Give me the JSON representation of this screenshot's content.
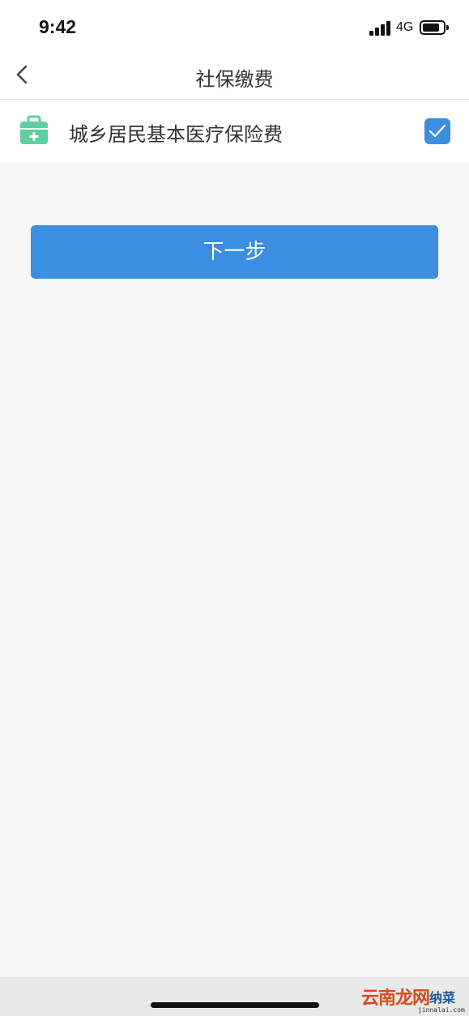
{
  "status_bar": {
    "time": "9:42",
    "network": "4G"
  },
  "nav": {
    "title": "社保缴费"
  },
  "item": {
    "label": "城乡居民基本医疗保险费",
    "checked": true,
    "icon": "medical-kit-icon",
    "icon_color": "#5dcfa0"
  },
  "actions": {
    "next_label": "下一步"
  },
  "colors": {
    "accent": "#3b8ee0",
    "background": "#f6f6f6"
  },
  "watermark": {
    "text_main": "云南龙网",
    "text_side": "纳菜",
    "url": "jinnalai.com"
  }
}
